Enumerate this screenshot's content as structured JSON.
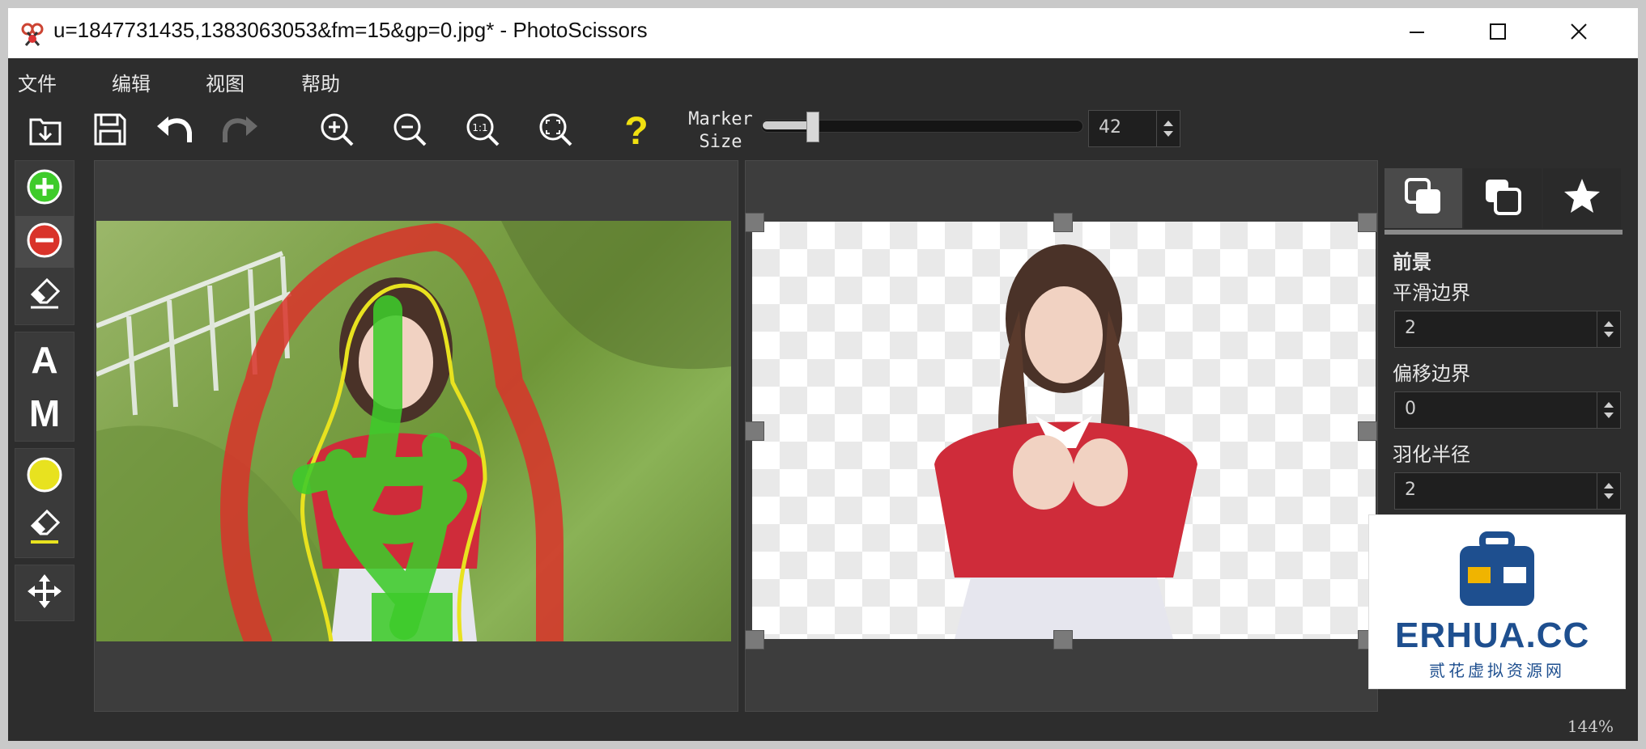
{
  "window": {
    "title": "u=1847731435,1383063053&fm=15&gp=0.jpg* - PhotoScissors",
    "minimize_icon": "minimize-icon",
    "maximize_icon": "maximize-icon",
    "close_icon": "close-icon"
  },
  "menu": {
    "items": [
      "文件",
      "编辑",
      "视图",
      "帮助"
    ]
  },
  "toolbar": {
    "buttons": [
      "open-icon",
      "save-icon",
      "undo-icon",
      "redo-icon",
      "zoom-in-icon",
      "zoom-out-icon",
      "zoom-actual-icon",
      "zoom-fit-icon",
      "help-icon"
    ],
    "marker_label_1": "Marker",
    "marker_label_2": "Size",
    "marker_size": "42",
    "marker_fraction": 0.15
  },
  "left_tools": {
    "letter_a": "A",
    "letter_m": "M",
    "icons": [
      "foreground-marker-icon",
      "background-marker-icon",
      "eraser-icon",
      "auto-mode",
      "manual-mode",
      "edge-color-icon",
      "edge-eraser-icon",
      "move-icon"
    ]
  },
  "right_panel": {
    "tabs": [
      "foreground-tab-icon",
      "background-tab-icon",
      "star-tab-icon"
    ],
    "section_title": "前景",
    "smooth_label": "平滑边界",
    "smooth_value": "2",
    "offset_label": "偏移边界",
    "offset_value": "0",
    "feather_label": "羽化半径",
    "feather_value": "2"
  },
  "status": {
    "zoom": "144%"
  },
  "watermark": {
    "brand": "ERHUA.CC",
    "subtitle": "贰花虚拟资源网"
  },
  "colors": {
    "foreground_marker": "#3ecb2a",
    "background_marker": "#d9332a",
    "edge_marker": "#e8e21f",
    "help_icon": "#f0e010",
    "brand": "#1e4f8f"
  }
}
